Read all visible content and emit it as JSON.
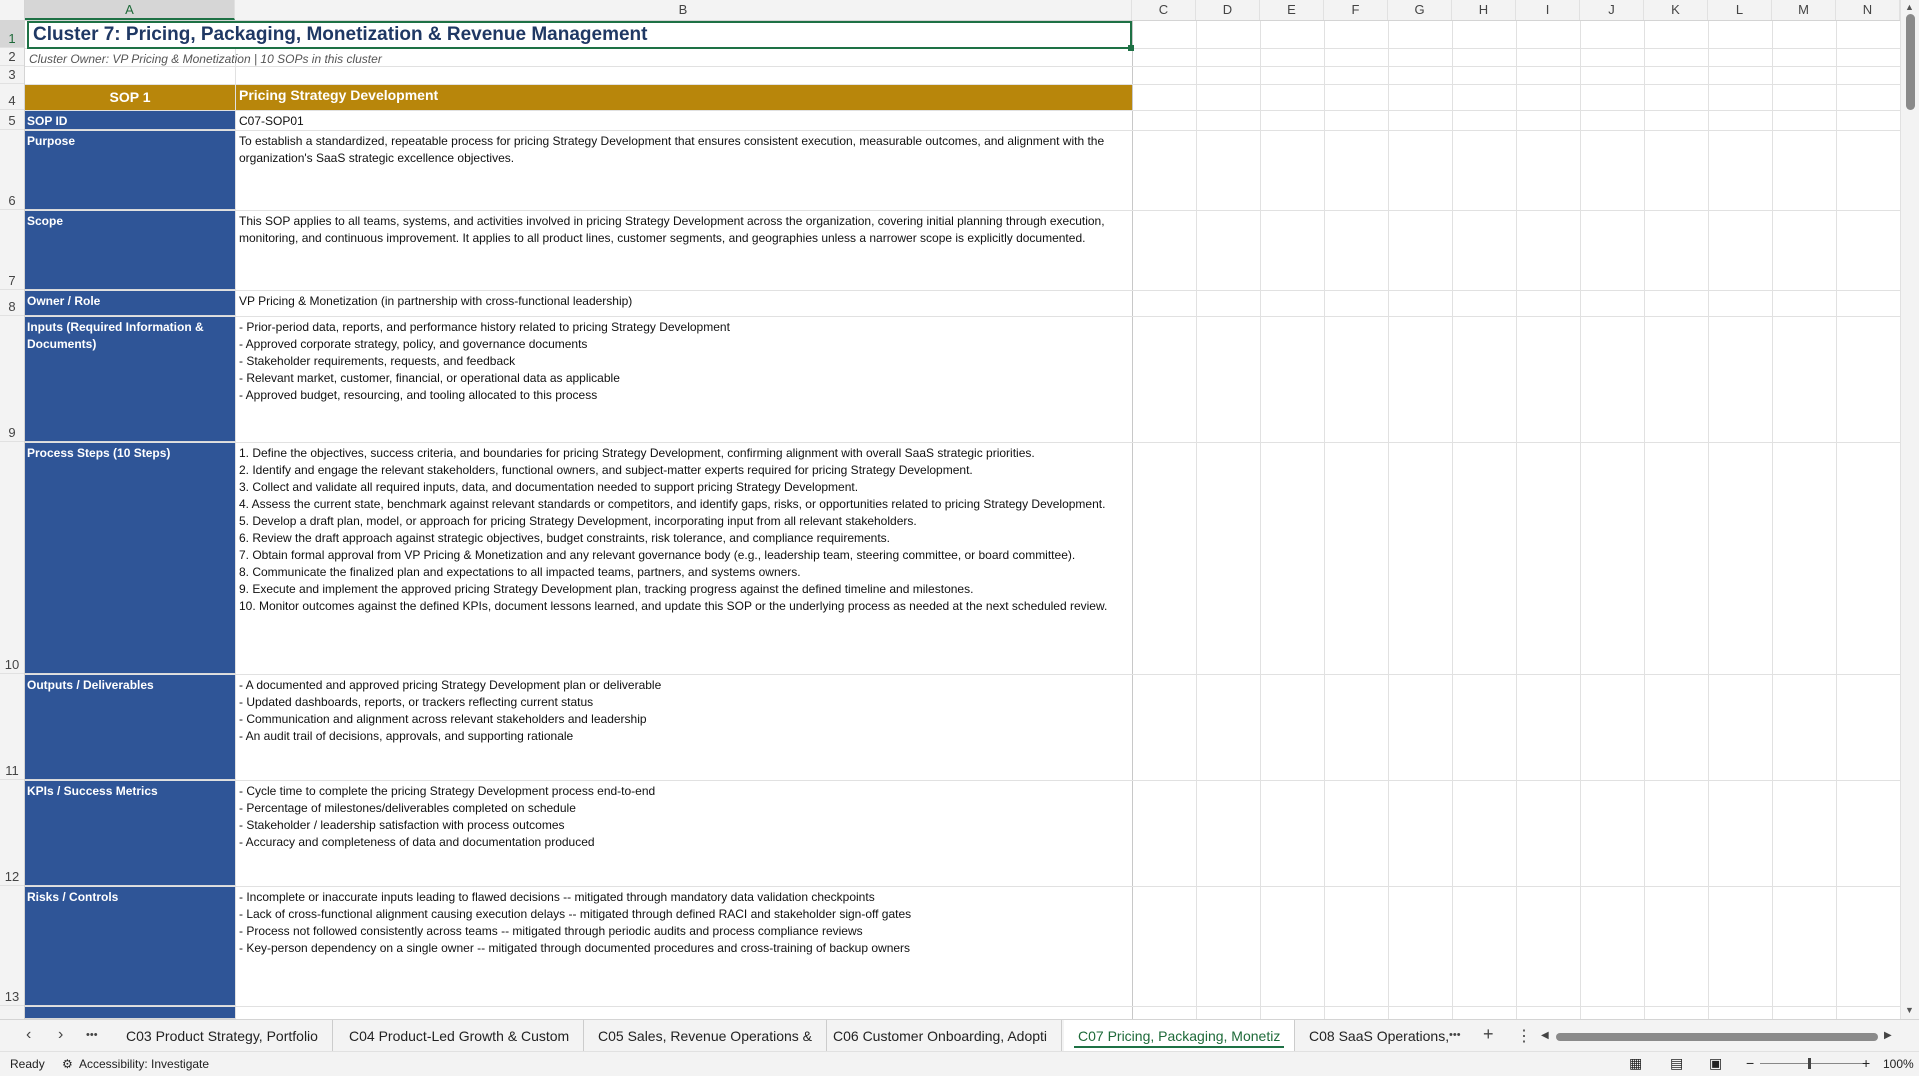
{
  "sheet": {
    "columns": [
      "A",
      "B",
      "C",
      "D",
      "E",
      "F",
      "G",
      "H",
      "I",
      "J",
      "K",
      "L",
      "M",
      "N"
    ],
    "selected_column": "A",
    "rows": [
      "1",
      "2",
      "3",
      "4",
      "5",
      "6",
      "7",
      "8",
      "9",
      "10",
      "11",
      "12",
      "13"
    ],
    "selected_row": "1",
    "title": "Cluster 7: Pricing, Packaging, Monetization & Revenue Management",
    "subtitle": "Cluster Owner: VP Pricing & Monetization  |  10 SOPs in this cluster",
    "sop_header": {
      "label": "SOP 1",
      "name": "Pricing Strategy Development"
    },
    "fields": [
      {
        "label": "SOP ID",
        "value": "C07-SOP01"
      },
      {
        "label": "Purpose",
        "value": "To establish a standardized, repeatable process for pricing Strategy Development that ensures consistent execution, measurable outcomes, and alignment with the organization's SaaS strategic excellence objectives."
      },
      {
        "label": "Scope",
        "value": "This SOP applies to all teams, systems, and activities involved in pricing Strategy Development across the organization, covering initial planning through execution, monitoring, and continuous improvement. It applies to all product lines, customer segments, and geographies unless a narrower scope is explicitly documented."
      },
      {
        "label": "Owner / Role",
        "value": "VP Pricing & Monetization (in partnership with cross-functional leadership)"
      },
      {
        "label": "Inputs (Required Information & Documents)",
        "value": "- Prior-period data, reports, and performance history related to pricing Strategy Development\n- Approved corporate strategy, policy, and governance documents\n- Stakeholder requirements, requests, and feedback\n- Relevant market, customer, financial, or operational data as applicable\n- Approved budget, resourcing, and tooling allocated to this process"
      },
      {
        "label": "Process Steps (10 Steps)",
        "value": "1. Define the objectives, success criteria, and boundaries for pricing Strategy Development, confirming alignment with overall SaaS strategic priorities.\n2. Identify and engage the relevant stakeholders, functional owners, and subject-matter experts required for pricing Strategy Development.\n3. Collect and validate all required inputs, data, and documentation needed to support pricing Strategy Development.\n4. Assess the current state, benchmark against relevant standards or competitors, and identify gaps, risks, or opportunities related to pricing Strategy Development.\n5. Develop a draft plan, model, or approach for pricing Strategy Development, incorporating input from all relevant stakeholders.\n6. Review the draft approach against strategic objectives, budget constraints, risk tolerance, and compliance requirements.\n7. Obtain formal approval from VP Pricing & Monetization and any relevant governance body (e.g., leadership team, steering committee, or board committee).\n8. Communicate the finalized plan and expectations to all impacted teams, partners, and systems owners.\n9. Execute and implement the approved pricing Strategy Development plan, tracking progress against the defined timeline and milestones.\n10. Monitor outcomes against the defined KPIs, document lessons learned, and update this SOP or the underlying process as needed at the next scheduled review."
      },
      {
        "label": "Outputs / Deliverables",
        "value": "- A documented and approved pricing Strategy Development plan or deliverable\n- Updated dashboards, reports, or trackers reflecting current status\n- Communication and alignment across relevant stakeholders and leadership\n- An audit trail of decisions, approvals, and supporting rationale"
      },
      {
        "label": "KPIs / Success Metrics",
        "value": "- Cycle time to complete the pricing Strategy Development process end-to-end\n- Percentage of milestones/deliverables completed on schedule\n- Stakeholder / leadership satisfaction with process outcomes\n- Accuracy and completeness of data and documentation produced"
      },
      {
        "label": "Risks / Controls",
        "value": "- Incomplete or inaccurate inputs leading to flawed decisions -- mitigated through mandatory data validation checkpoints\n- Lack of cross-functional alignment causing execution delays -- mitigated through defined RACI and stakeholder sign-off gates\n- Process not followed consistently across teams -- mitigated through periodic audits and process compliance reviews\n- Key-person dependency on a single owner -- mitigated through documented procedures and cross-training of backup owners"
      }
    ]
  },
  "tabs": {
    "prev_icon": "chevron-left-icon",
    "next_icon": "chevron-right-icon",
    "more_left": "•••",
    "items": [
      "C03 Product Strategy, Portfolio",
      "C04 Product-Led Growth & Custom",
      "C05 Sales, Revenue Operations &",
      "C06 Customer Onboarding, Adopti",
      "C07 Pricing, Packaging, Monetiz",
      "C08 SaaS Operations,"
    ],
    "active_index": 4,
    "more_right": "•••",
    "add": "+",
    "menu": "⋮"
  },
  "status": {
    "ready": "Ready",
    "accessibility": "Accessibility: Investigate",
    "zoom": "100%",
    "zoom_minus": "−",
    "zoom_plus": "+"
  }
}
